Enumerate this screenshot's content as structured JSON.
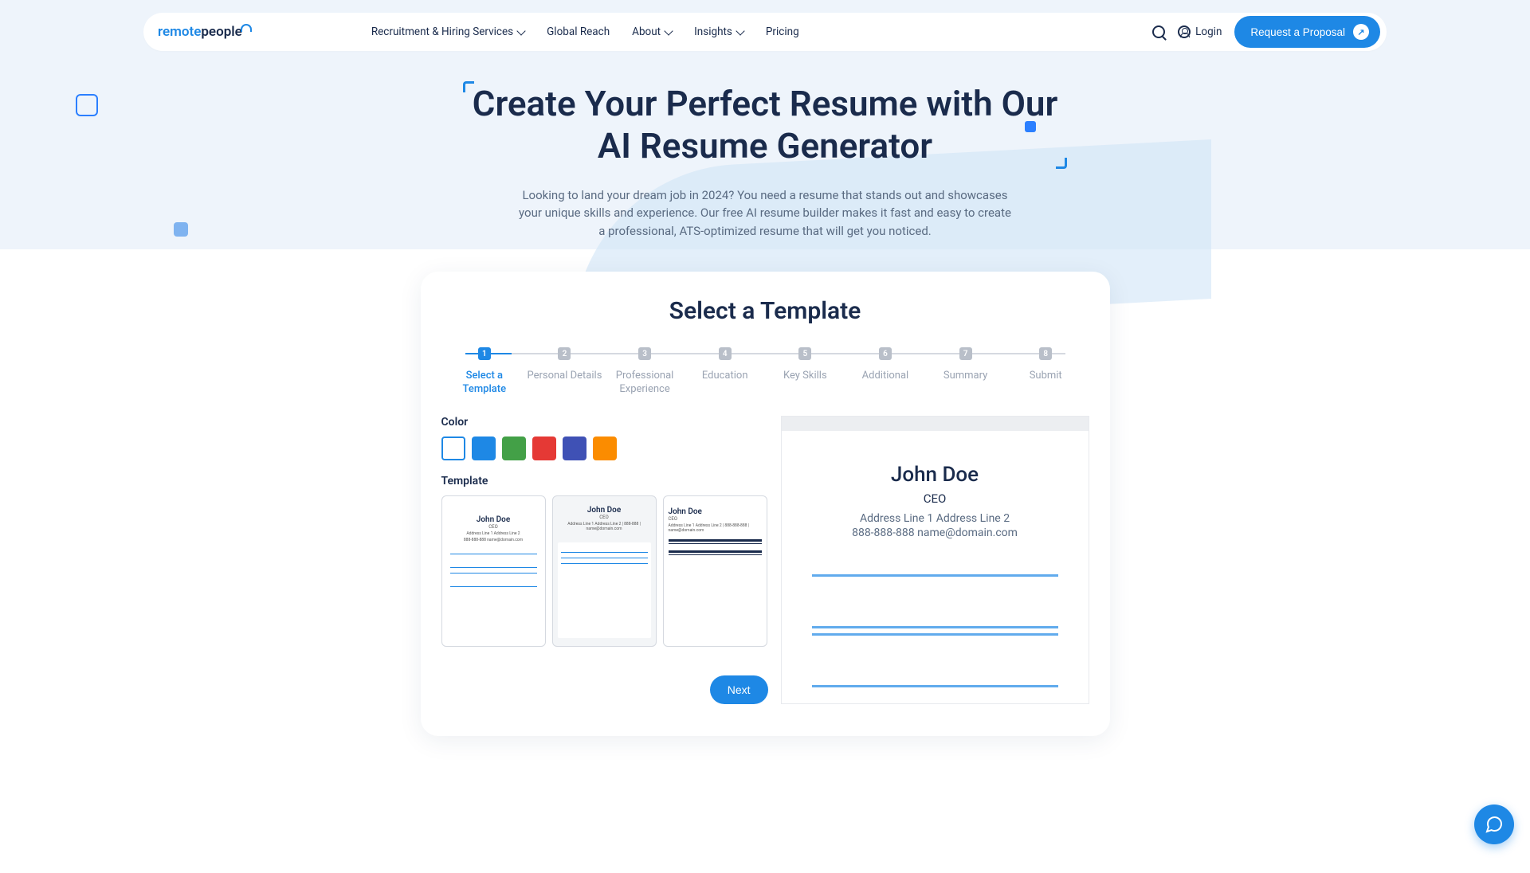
{
  "brand": {
    "word1": "remote",
    "word2": "people"
  },
  "nav": {
    "item1": "Recruitment & Hiring Services",
    "item2": "Global Reach",
    "item3": "About",
    "item4": "Insights",
    "item5": "Pricing"
  },
  "header": {
    "login": "Login",
    "cta": "Request a Proposal"
  },
  "hero": {
    "title_l1": "Create Your Perfect Resume with Our",
    "title_l2": "AI Resume Generator",
    "sub": "Looking to land your dream job in 2024? You need a resume that stands out and showcases your unique skills and experience. Our free AI resume builder makes it fast and easy to create a professional, ATS-optimized resume that will get you noticed."
  },
  "card": {
    "title": "Select a Template",
    "steps": [
      {
        "n": "1",
        "label": "Select a Template"
      },
      {
        "n": "2",
        "label": "Personal Details"
      },
      {
        "n": "3",
        "label": "Professional Experience"
      },
      {
        "n": "4",
        "label": "Education"
      },
      {
        "n": "5",
        "label": "Key Skills"
      },
      {
        "n": "6",
        "label": "Additional"
      },
      {
        "n": "7",
        "label": "Summary"
      },
      {
        "n": "8",
        "label": "Submit"
      }
    ],
    "color_label": "Color",
    "template_label": "Template",
    "next": "Next"
  },
  "colors": [
    "#ffffff",
    "#1e88e5",
    "#43a047",
    "#e53935",
    "#3f51b5",
    "#fb8c00"
  ],
  "sample": {
    "name": "John Doe",
    "role": "CEO",
    "addr": "Address Line 1 Address Line 2",
    "contact": "888-888-888 name@domain.com",
    "addr_combo": "Address Line 1 Address Line 2 | 888-888 | name@domain.com",
    "addr_combo2": "Address Line 1 Address Line 2 | 888-888-888 | name@domain.com"
  }
}
